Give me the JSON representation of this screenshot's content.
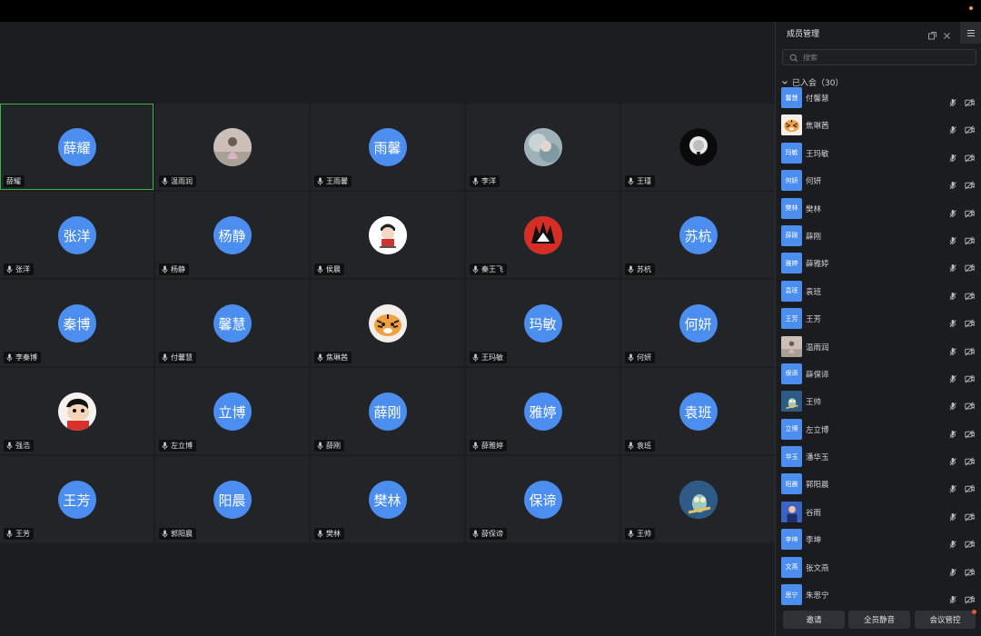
{
  "colors": {
    "accent": "#4b8ef0",
    "active_border": "#3db34a",
    "background": "#1c1d20",
    "tile": "#232427"
  },
  "tiles": [
    {
      "avatar_text": "薛耀",
      "name": "薛耀",
      "active": true,
      "mic": false
    },
    {
      "avatar_text": "",
      "avatar_icon": "photo-girl-icon",
      "name": "温雨润",
      "mic": true
    },
    {
      "avatar_text": "雨馨",
      "name": "王雨馨",
      "mic": true
    },
    {
      "avatar_text": "",
      "avatar_icon": "photo-blurry-icon",
      "name": "李洋",
      "mic": true
    },
    {
      "avatar_text": "",
      "avatar_icon": "photo-dark-icon",
      "name": "王瑾",
      "mic": true
    },
    {
      "avatar_text": "张洋",
      "name": "张洋",
      "mic": true
    },
    {
      "avatar_text": "杨静",
      "name": "杨静",
      "mic": true
    },
    {
      "avatar_text": "",
      "avatar_icon": "photo-cartoon-man-icon",
      "name": "侯晨",
      "mic": true
    },
    {
      "avatar_text": "",
      "avatar_icon": "photo-anime-icon",
      "name": "秦王飞",
      "mic": true
    },
    {
      "avatar_text": "苏杭",
      "name": "苏杭",
      "mic": true
    },
    {
      "avatar_text": "秦博",
      "name": "李秦博",
      "mic": true
    },
    {
      "avatar_text": "馨慧",
      "name": "付馨慧",
      "mic": true
    },
    {
      "avatar_text": "",
      "avatar_icon": "photo-tiger-icon",
      "name": "焦琳茜",
      "mic": true
    },
    {
      "avatar_text": "玛敏",
      "name": "王玛敏",
      "mic": true
    },
    {
      "avatar_text": "何妍",
      "name": "何妍",
      "mic": true
    },
    {
      "avatar_text": "",
      "avatar_icon": "photo-shinchan-icon",
      "name": "强浩",
      "mic": true
    },
    {
      "avatar_text": "立博",
      "name": "左立博",
      "mic": true
    },
    {
      "avatar_text": "薛刚",
      "name": "薛刚",
      "mic": true
    },
    {
      "avatar_text": "雅婷",
      "name": "薛雅婷",
      "mic": true
    },
    {
      "avatar_text": "袁班",
      "name": "袁班",
      "mic": true
    },
    {
      "avatar_text": "王芳",
      "name": "王芳",
      "mic": true
    },
    {
      "avatar_text": "阳晨",
      "name": "郭阳晨",
      "mic": true
    },
    {
      "avatar_text": "樊林",
      "name": "樊林",
      "mic": true
    },
    {
      "avatar_text": "保谛",
      "name": "薛保谛",
      "mic": true
    },
    {
      "avatar_text": "",
      "avatar_icon": "photo-squidward-icon",
      "name": "王帅",
      "mic": true
    }
  ],
  "panel": {
    "title": "成员管理",
    "search_placeholder": "搜索",
    "section_label": "已入会（30）",
    "members": [
      {
        "avatar_text": "馨慧",
        "name": "付馨慧"
      },
      {
        "avatar_text": "",
        "avatar_icon": "photo-tiger-icon",
        "name": "焦琳茜"
      },
      {
        "avatar_text": "玛敏",
        "name": "王玛敏"
      },
      {
        "avatar_text": "何妍",
        "name": "何妍"
      },
      {
        "avatar_text": "樊林",
        "name": "樊林"
      },
      {
        "avatar_text": "薛刚",
        "name": "薛刚"
      },
      {
        "avatar_text": "雅婷",
        "name": "薛雅婷"
      },
      {
        "avatar_text": "袁班",
        "name": "袁班"
      },
      {
        "avatar_text": "王芳",
        "name": "王芳"
      },
      {
        "avatar_text": "",
        "avatar_icon": "photo-girl-icon",
        "name": "温雨润"
      },
      {
        "avatar_text": "保谛",
        "name": "薛保谛"
      },
      {
        "avatar_text": "",
        "avatar_icon": "photo-squidward-icon",
        "name": "王帅"
      },
      {
        "avatar_text": "立博",
        "name": "左立博"
      },
      {
        "avatar_text": "华玉",
        "name": "潘华玉"
      },
      {
        "avatar_text": "阳晨",
        "name": "郭阳晨"
      },
      {
        "avatar_text": "",
        "avatar_icon": "photo-blue-icon",
        "name": "谷雨"
      },
      {
        "avatar_text": "李坤",
        "name": "李坤"
      },
      {
        "avatar_text": "文燕",
        "name": "张文燕"
      },
      {
        "avatar_text": "思宁",
        "name": "朱思宁"
      }
    ],
    "buttons": {
      "invite": "邀请",
      "mute_all": "全员静音",
      "meeting_control": "会议管控"
    }
  }
}
